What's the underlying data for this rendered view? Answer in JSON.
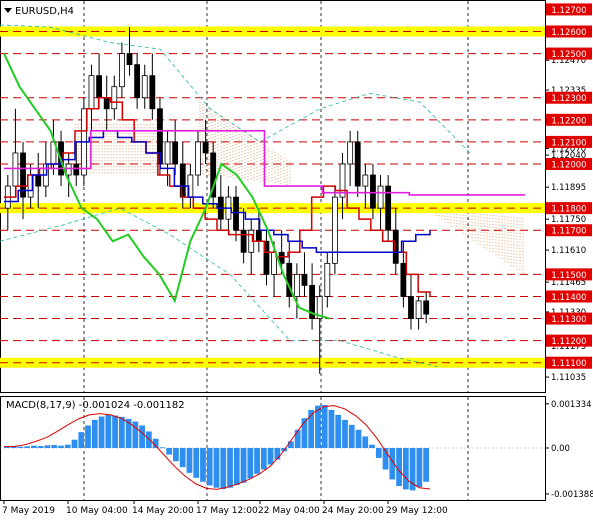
{
  "chart_data": [
    {
      "type": "candlestick",
      "title": "EURUSD,H4",
      "ylim": [
        1.1099,
        1.1272
      ],
      "x_labels": [
        "7 May 2019",
        "10 May 04:00",
        "14 May 20:00",
        "17 May 12:00",
        "22 May 04:00",
        "24 May 20:00",
        "29 May 12:00"
      ],
      "y_ticks": [
        "1.12700",
        "1.12600",
        "1.12470",
        "1.12335",
        "1.12200",
        "1.12070",
        "1.12040",
        "1.11895",
        "1.11750",
        "1.11610",
        "1.11465",
        "1.11330",
        "1.11175",
        "1.11035"
      ],
      "levels": [
        {
          "label": "1.12700",
          "value": 1.127,
          "style": "none"
        },
        {
          "label": "1.12600",
          "value": 1.126,
          "style": "yellow-band"
        },
        {
          "label": "1.12500",
          "value": 1.125,
          "style": "red-dash"
        },
        {
          "label": "1.12300",
          "value": 1.123,
          "style": "red-dash"
        },
        {
          "label": "1.12200",
          "value": 1.122,
          "style": "red-dash"
        },
        {
          "label": "1.12100",
          "value": 1.121,
          "style": "red-dash"
        },
        {
          "label": "1.12000",
          "value": 1.12,
          "style": "red-dash"
        },
        {
          "label": "1.11800",
          "value": 1.118,
          "style": "yellow-band"
        },
        {
          "label": "1.11700",
          "value": 1.117,
          "style": "red-dash"
        },
        {
          "label": "1.11500",
          "value": 1.115,
          "style": "red-dash"
        },
        {
          "label": "1.11400",
          "value": 1.114,
          "style": "red-dash"
        },
        {
          "label": "1.11300",
          "value": 1.113,
          "style": "red-dash"
        },
        {
          "label": "1.11200",
          "value": 1.112,
          "style": "red-dash"
        },
        {
          "label": "1.11100",
          "value": 1.111,
          "style": "yellow-band"
        }
      ],
      "candles": [
        [
          1.118,
          1.1195,
          1.117,
          1.119
        ],
        [
          1.119,
          1.1225,
          1.1185,
          1.1205
        ],
        [
          1.1205,
          1.121,
          1.1175,
          1.1185
        ],
        [
          1.1185,
          1.12,
          1.118,
          1.1195
        ],
        [
          1.1195,
          1.1205,
          1.118,
          1.119
        ],
        [
          1.119,
          1.121,
          1.1185,
          1.12
        ],
        [
          1.12,
          1.122,
          1.1195,
          1.121
        ],
        [
          1.121,
          1.1215,
          1.119,
          1.1195
        ],
        [
          1.1195,
          1.1205,
          1.1185,
          1.12
        ],
        [
          1.12,
          1.121,
          1.119,
          1.1195
        ],
        [
          1.1195,
          1.123,
          1.119,
          1.1225
        ],
        [
          1.1225,
          1.1245,
          1.1215,
          1.124
        ],
        [
          1.124,
          1.125,
          1.1225,
          1.123
        ],
        [
          1.123,
          1.124,
          1.1215,
          1.1225
        ],
        [
          1.1225,
          1.124,
          1.122,
          1.1235
        ],
        [
          1.1235,
          1.1255,
          1.123,
          1.125
        ],
        [
          1.125,
          1.1262,
          1.124,
          1.1245
        ],
        [
          1.1245,
          1.125,
          1.1225,
          1.123
        ],
        [
          1.123,
          1.1245,
          1.1225,
          1.124
        ],
        [
          1.124,
          1.125,
          1.122,
          1.1225
        ],
        [
          1.1225,
          1.123,
          1.1195,
          1.12
        ],
        [
          1.12,
          1.1215,
          1.119,
          1.121
        ],
        [
          1.121,
          1.122,
          1.1195,
          1.12
        ],
        [
          1.12,
          1.121,
          1.118,
          1.1185
        ],
        [
          1.1185,
          1.12,
          1.118,
          1.1195
        ],
        [
          1.1195,
          1.1215,
          1.119,
          1.121
        ],
        [
          1.121,
          1.122,
          1.12,
          1.1205
        ],
        [
          1.1205,
          1.121,
          1.118,
          1.1185
        ],
        [
          1.1185,
          1.1195,
          1.117,
          1.1175
        ],
        [
          1.1175,
          1.119,
          1.1168,
          1.1185
        ],
        [
          1.1185,
          1.119,
          1.1165,
          1.117
        ],
        [
          1.117,
          1.118,
          1.1155,
          1.116
        ],
        [
          1.116,
          1.1175,
          1.115,
          1.117
        ],
        [
          1.117,
          1.118,
          1.116,
          1.1165
        ],
        [
          1.1165,
          1.117,
          1.1145,
          1.115
        ],
        [
          1.115,
          1.1165,
          1.114,
          1.116
        ],
        [
          1.116,
          1.117,
          1.115,
          1.1155
        ],
        [
          1.1155,
          1.1165,
          1.1135,
          1.114
        ],
        [
          1.114,
          1.1155,
          1.113,
          1.115
        ],
        [
          1.115,
          1.116,
          1.114,
          1.1145
        ],
        [
          1.1145,
          1.1155,
          1.1125,
          1.113
        ],
        [
          1.113,
          1.1145,
          1.1105,
          1.114
        ],
        [
          1.114,
          1.116,
          1.1135,
          1.1155
        ],
        [
          1.1155,
          1.119,
          1.115,
          1.1185
        ],
        [
          1.1185,
          1.1205,
          1.1175,
          1.12
        ],
        [
          1.12,
          1.1215,
          1.119,
          1.121
        ],
        [
          1.121,
          1.1215,
          1.1185,
          1.119
        ],
        [
          1.119,
          1.12,
          1.118,
          1.1195
        ],
        [
          1.1195,
          1.12,
          1.1175,
          1.118
        ],
        [
          1.118,
          1.1195,
          1.117,
          1.119
        ],
        [
          1.119,
          1.1195,
          1.1165,
          1.117
        ],
        [
          1.117,
          1.118,
          1.115,
          1.1155
        ],
        [
          1.1155,
          1.1165,
          1.1135,
          1.114
        ],
        [
          1.114,
          1.115,
          1.1125,
          1.113
        ],
        [
          1.113,
          1.114,
          1.1125,
          1.1138
        ],
        [
          1.1138,
          1.1142,
          1.1128,
          1.1132
        ]
      ],
      "indicator_lines": [
        {
          "name": "Tenkan-sen",
          "color": "#d00000",
          "values": [
            1.1185,
            1.119,
            1.1195,
            1.1198,
            1.12,
            1.1205,
            1.1215,
            1.1225,
            1.123,
            1.1228,
            1.122,
            1.121,
            1.1205,
            1.1195,
            1.119,
            1.1185,
            1.118,
            1.1175,
            1.117,
            1.1168,
            1.1168,
            1.1165,
            1.116,
            1.1158,
            1.116,
            1.117,
            1.1185,
            1.119,
            1.1188,
            1.118,
            1.1175,
            1.117,
            1.1165,
            1.116,
            1.115,
            1.1142,
            1.114
          ]
        },
        {
          "name": "Kijun-sen",
          "color": "#0000c8",
          "values": [
            1.1183,
            1.1188,
            1.1195,
            1.12,
            1.1202,
            1.121,
            1.1212,
            1.1215,
            1.1212,
            1.121,
            1.1205,
            1.1198,
            1.119,
            1.1185,
            1.1182,
            1.118,
            1.1178,
            1.1175,
            1.117,
            1.1168,
            1.1165,
            1.1162,
            1.116,
            1.116,
            1.116,
            1.116,
            1.116,
            1.116,
            1.1165,
            1.1168,
            1.117
          ]
        },
        {
          "name": "Senkou Span B",
          "color": "#e020e0",
          "values": [
            1.1198,
            1.1198,
            1.1198,
            1.1215,
            1.1215,
            1.1215,
            1.1215,
            1.1215,
            1.1215,
            1.119,
            1.119,
            1.1187,
            1.1187,
            1.1187,
            1.1186,
            1.1186,
            1.1186,
            1.1186,
            1.1186
          ]
        },
        {
          "name": "Chikou Span",
          "color": "#22cc22",
          "values": [
            1.125,
            1.1235,
            1.1225,
            1.1215,
            1.1195,
            1.118,
            1.1175,
            1.1165,
            1.1168,
            1.1158,
            1.115,
            1.1138,
            1.1165,
            1.118,
            1.12,
            1.1195,
            1.1185,
            1.117,
            1.115,
            1.1135,
            1.1132,
            1.113
          ]
        }
      ]
    },
    {
      "type": "bar",
      "title": "MACD(8,17,9) -0.001024 -0.001182",
      "ylim": [
        -0.00145,
        0.00145
      ],
      "y_ticks": [
        "0.001334",
        "0.00",
        "-0.001388"
      ],
      "values": [
        6e-05,
        5e-05,
        4e-05,
        5e-05,
        7e-05,
        6e-05,
        8e-05,
        9e-05,
        7e-05,
        0.0001,
        0.00025,
        0.00048,
        0.00068,
        0.00085,
        0.00095,
        0.001,
        0.00098,
        0.00094,
        0.00088,
        0.0008,
        0.00068,
        0.0005,
        0.00028,
        2e-05,
        -0.0002,
        -0.0004,
        -0.00058,
        -0.00075,
        -0.0009,
        -0.00102,
        -0.00113,
        -0.0012,
        -0.00124,
        -0.0012,
        -0.00112,
        -0.00105,
        -0.00092,
        -0.00078,
        -0.00065,
        -0.0005,
        -0.00035,
        -0.0001,
        0.0002,
        0.00055,
        0.0009,
        0.00115,
        0.00128,
        0.0013,
        0.00115,
        0.001,
        0.00085,
        0.0007,
        0.00055,
        0.00035,
        0.0001,
        -0.0003,
        -0.00065,
        -0.00095,
        -0.00115,
        -0.00125,
        -0.00128,
        -0.00118,
        -0.00102
      ],
      "signal": [
        4e-05,
        5e-05,
        0.0001,
        0.0002,
        0.00032,
        0.0005,
        0.0007,
        0.00088,
        0.001,
        0.00104,
        0.001,
        0.0009,
        0.0007,
        0.00045,
        0.00015,
        -0.0002,
        -0.00055,
        -0.00085,
        -0.00108,
        -0.00122,
        -0.00125,
        -0.00118,
        -0.00108,
        -0.00095,
        -0.00078,
        -0.00055,
        -0.0002,
        0.00025,
        0.0007,
        0.00105,
        0.00125,
        0.00128,
        0.00118,
        0.00098,
        0.0007,
        0.0003,
        -0.00018,
        -0.00065,
        -0.001,
        -0.0012,
        -0.00124
      ]
    }
  ]
}
